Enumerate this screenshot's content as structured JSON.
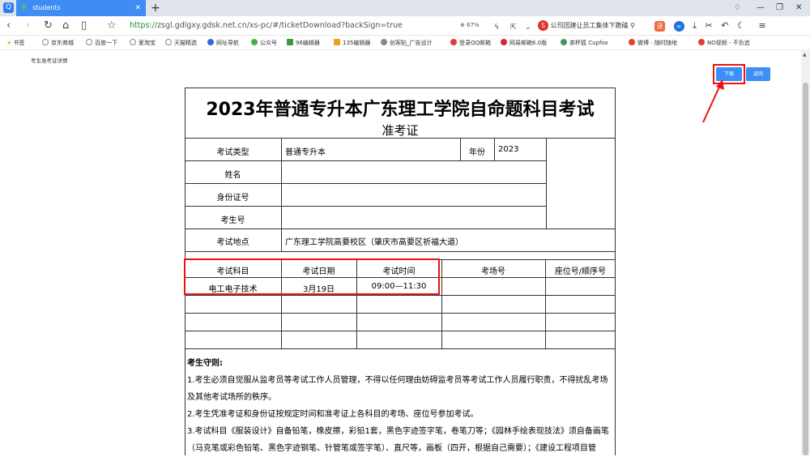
{
  "browser": {
    "tab_title": "students",
    "url_protocol": "https://",
    "url_rest": "zsgl.gdlgxy.gdsk.net.cn/xs-pc/#/ticketDownload?backSign=true",
    "zoom": "67%",
    "search_hint": "公司团建让员工集体下跪磕",
    "bookmarks": [
      "书签",
      "京东商城",
      "百度一下",
      "爱淘宝",
      "天猫精选",
      "网址导航",
      "公众号",
      "96编辑器",
      "135编辑器",
      "创客贴_广告设计",
      "登录QQ邮箱",
      "网易邮箱6.0版",
      "茶杯狐 Cupfox",
      "微博 - 随时随地",
      "NO视频 - 不负追"
    ]
  },
  "page": {
    "breadcrumb": "考生准考证详情",
    "download_label": "下载",
    "back_label": "返回"
  },
  "ticket": {
    "title": "2023年普通专升本广东理工学院自命题科目考试",
    "subtitle": "准考证",
    "exam_type_label": "考试类型",
    "exam_type_value": "普通专升本",
    "year_label": "年份",
    "year_value": "2023",
    "name_label": "姓名",
    "id_label": "身份证号",
    "student_no_label": "考生号",
    "location_label": "考试地点",
    "location_value": "广东理工学院高要校区（肇庆市高要区祈福大道）",
    "columns": [
      "考试科目",
      "考试日期",
      "考试时间",
      "考场号",
      "座位号/顺序号"
    ],
    "row1": {
      "subject": "电工电子技术",
      "date": "3月19日",
      "time": "09:00—11:30",
      "room": "",
      "seat": ""
    }
  },
  "rules": {
    "heading": "考生守则:",
    "rule1a": "1.考生必须自觉服从监考员等考试工作人员管理，不得以任何理由妨碍监考员等考试工作人员履行职责，不得扰乱考场",
    "rule1b": "及其他考试场所的秩序。",
    "rule2": "2.考生凭准考证和身份证按规定时间和准考证上各科目的考场、座位号参加考试。",
    "rule3a": "3.考试科目《服装设计》自备铅笔，橡皮擦，彩铅1套，黑色字迹签字笔，卷笔刀等；《园林手绘表现技法》须自备画笔",
    "rule3b": "（马克笔或彩色铅笔、黑色字迹钢笔、针管笔或签字笔）、直尺等，画板（四开，根据自己需要）；《建设工程项目管"
  },
  "colors": {
    "accent": "#3c8ff6",
    "annotation": "#e11111"
  }
}
